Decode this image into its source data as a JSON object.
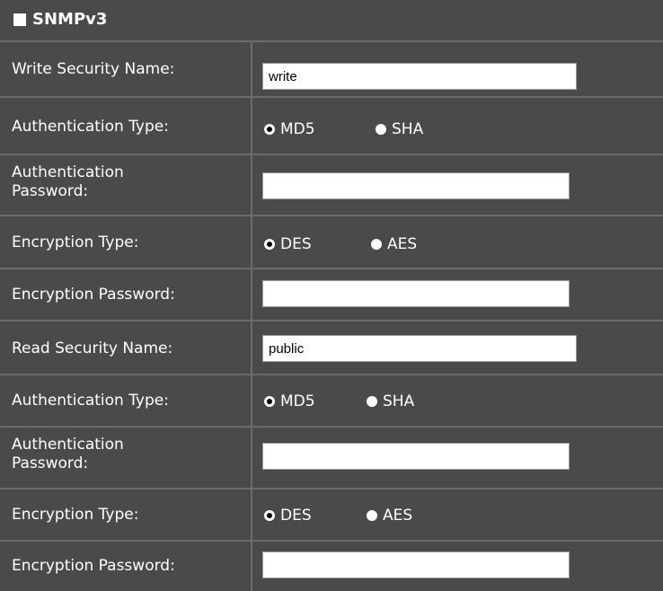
{
  "section": {
    "title": "SNMPv3"
  },
  "write": {
    "security_name_label": "Write Security Name:",
    "security_name_value": "write",
    "auth_type_label": "Authentication Type:",
    "auth_options": [
      "MD5",
      "SHA"
    ],
    "auth_selected": "MD5",
    "auth_password_label_1": "Authentication",
    "auth_password_label_2": "Password:",
    "auth_password_value": "",
    "enc_type_label": "Encryption Type:",
    "enc_options": [
      "DES",
      "AES"
    ],
    "enc_selected": "DES",
    "enc_password_label": "Encryption Password:",
    "enc_password_value": ""
  },
  "read": {
    "security_name_label": "Read Security Name:",
    "security_name_value": "public",
    "auth_type_label": "Authentication Type:",
    "auth_options": [
      "MD5",
      "SHA"
    ],
    "auth_selected": "MD5",
    "auth_password_label_1": "Authentication",
    "auth_password_label_2": "Password:",
    "auth_password_value": "",
    "enc_type_label": "Encryption Type:",
    "enc_options": [
      "DES",
      "AES"
    ],
    "enc_selected": "DES",
    "enc_password_label": "Encryption Password:",
    "enc_password_value": ""
  },
  "colors": {
    "panel_bg": "#4a4a4a",
    "grid_line": "#6b6b6b",
    "text": "#ffffff"
  }
}
